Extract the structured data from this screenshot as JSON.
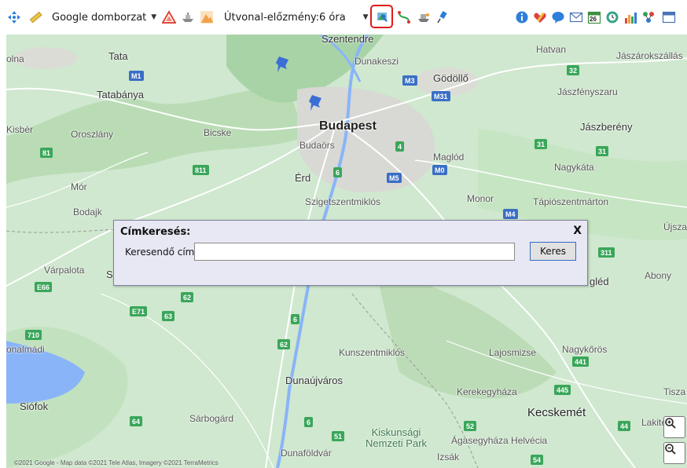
{
  "toolbar": {
    "map_type_select": {
      "value": "Google domborzat"
    },
    "route_history": {
      "label": "Útvonal-előzmény:",
      "value": "6 óra"
    },
    "icons": {
      "left": [
        "move-icon",
        "ruler-icon",
        "triangle-warning-icon",
        "ship-icon",
        "mountain-icon"
      ],
      "middle": [
        "search-place-icon",
        "route-icon",
        "vehicle-icon",
        "pin-icon"
      ],
      "right": [
        "info-icon",
        "heart-icon",
        "speech-bubble-icon",
        "envelope-icon",
        "calendar-icon",
        "clock-icon",
        "bar-chart-icon",
        "tree-icon",
        "window-icon"
      ]
    },
    "calendar_day": "26"
  },
  "map": {
    "places": [
      {
        "id": "szentendre",
        "name": "Szentendre",
        "kind": "mid"
      },
      {
        "id": "hatvan",
        "name": "Hatvan",
        "kind": "small"
      },
      {
        "id": "jaszarokszallas",
        "name": "Jászárokszállás",
        "kind": "small"
      },
      {
        "id": "olna",
        "name": "olna",
        "kind": "small"
      },
      {
        "id": "tata",
        "name": "Tata",
        "kind": "mid"
      },
      {
        "id": "dunakeszi",
        "name": "Dunakeszi",
        "kind": "small"
      },
      {
        "id": "godollo",
        "name": "Gödöllő",
        "kind": "mid"
      },
      {
        "id": "tatabanya",
        "name": "Tatabánya",
        "kind": "mid"
      },
      {
        "id": "jaszfenyszaru",
        "name": "Jászfényszaru",
        "kind": "small"
      },
      {
        "id": "kisber",
        "name": "Kisbér",
        "kind": "small"
      },
      {
        "id": "oroszlany",
        "name": "Oroszlány",
        "kind": "small"
      },
      {
        "id": "bicske",
        "name": "Bicske",
        "kind": "small"
      },
      {
        "id": "budapest",
        "name": "Budapest",
        "kind": "big"
      },
      {
        "id": "jaszbereny",
        "name": "Jászberény",
        "kind": "mid"
      },
      {
        "id": "budaors",
        "name": "Budaörs",
        "kind": "small"
      },
      {
        "id": "maglod",
        "name": "Maglód",
        "kind": "small"
      },
      {
        "id": "nagykata",
        "name": "Nagykáta",
        "kind": "small"
      },
      {
        "id": "erd",
        "name": "Érd",
        "kind": "mid"
      },
      {
        "id": "mor",
        "name": "Mór",
        "kind": "small"
      },
      {
        "id": "szigetszentmiklos",
        "name": "Szigetszentmiklós",
        "kind": "small"
      },
      {
        "id": "monor",
        "name": "Monor",
        "kind": "small"
      },
      {
        "id": "tapioszentmarton",
        "name": "Tápiószentmárton",
        "kind": "small"
      },
      {
        "id": "bodajk",
        "name": "Bodajk",
        "kind": "small"
      },
      {
        "id": "ujsza",
        "name": "Újsza",
        "kind": "small"
      },
      {
        "id": "varpalota",
        "name": "Várpalota",
        "kind": "small"
      },
      {
        "id": "s_frag",
        "name": "S",
        "kind": "mid"
      },
      {
        "id": "cegled",
        "name": "gléd",
        "kind": "mid"
      },
      {
        "id": "abony",
        "name": "Abony",
        "kind": "small"
      },
      {
        "id": "balatonalmadi",
        "name": "onalmádi",
        "kind": "small"
      },
      {
        "id": "kunszentmiklos",
        "name": "Kunszentmiklós",
        "kind": "small"
      },
      {
        "id": "lajosmizse",
        "name": "Lajosmizse",
        "kind": "small"
      },
      {
        "id": "nagykoros",
        "name": "Nagykőrös",
        "kind": "small"
      },
      {
        "id": "dunaujvaros",
        "name": "Dunaújváros",
        "kind": "mid"
      },
      {
        "id": "kerekegyhaza",
        "name": "Kerekegyháza",
        "kind": "small"
      },
      {
        "id": "tisza",
        "name": "Tisza",
        "kind": "small"
      },
      {
        "id": "siofok",
        "name": "Siófok",
        "kind": "mid"
      },
      {
        "id": "sarbogard",
        "name": "Sárbogárd",
        "kind": "small"
      },
      {
        "id": "kecskemet",
        "name": "Kecskemét",
        "kind": "big-ish"
      },
      {
        "id": "lakite",
        "name": "Lakite",
        "kind": "small"
      },
      {
        "id": "kiskunsagi",
        "name": "Kiskunsági\nNemzeti Park",
        "kind": "park"
      },
      {
        "id": "agasegyhaza",
        "name": "Ágasegyháza Helvécia",
        "kind": "small"
      },
      {
        "id": "dunafoldvar",
        "name": "Dunaföldvár",
        "kind": "small"
      },
      {
        "id": "izsak",
        "name": "Izsák",
        "kind": "small"
      }
    ],
    "shields": [
      {
        "id": "s32",
        "label": "32",
        "color": "green"
      },
      {
        "id": "sm1",
        "label": "M1",
        "color": "blue"
      },
      {
        "id": "sm3",
        "label": "M3",
        "color": "blue"
      },
      {
        "id": "sm31",
        "label": "M31",
        "color": "blue"
      },
      {
        "id": "s81",
        "label": "81",
        "color": "green"
      },
      {
        "id": "s4",
        "label": "4",
        "color": "green"
      },
      {
        "id": "s31a",
        "label": "31",
        "color": "green"
      },
      {
        "id": "s31b",
        "label": "31",
        "color": "green"
      },
      {
        "id": "s811",
        "label": "811",
        "color": "green"
      },
      {
        "id": "s6a",
        "label": "6",
        "color": "green"
      },
      {
        "id": "sm5",
        "label": "M5",
        "color": "blue"
      },
      {
        "id": "sm0",
        "label": "M0",
        "color": "blue"
      },
      {
        "id": "sm4",
        "label": "M4",
        "color": "blue"
      },
      {
        "id": "s311",
        "label": "311",
        "color": "green"
      },
      {
        "id": "se66",
        "label": "E66",
        "color": "green"
      },
      {
        "id": "s62a",
        "label": "62",
        "color": "green"
      },
      {
        "id": "se71",
        "label": "E71",
        "color": "green"
      },
      {
        "id": "s63",
        "label": "63",
        "color": "green"
      },
      {
        "id": "s6b",
        "label": "6",
        "color": "green"
      },
      {
        "id": "s710",
        "label": "710",
        "color": "green"
      },
      {
        "id": "s62b",
        "label": "62",
        "color": "green"
      },
      {
        "id": "s441",
        "label": "441",
        "color": "green"
      },
      {
        "id": "s445",
        "label": "445",
        "color": "green"
      },
      {
        "id": "s64",
        "label": "64",
        "color": "green"
      },
      {
        "id": "s6c",
        "label": "6",
        "color": "green"
      },
      {
        "id": "s51",
        "label": "51",
        "color": "green"
      },
      {
        "id": "s52",
        "label": "52",
        "color": "green"
      },
      {
        "id": "s44",
        "label": "44",
        "color": "green"
      },
      {
        "id": "s54",
        "label": "54",
        "color": "green"
      }
    ],
    "copyright": "©2021 Google - Map data ©2021 Tele Atlas, Imagery ©2021 TerraMetrics"
  },
  "dialog": {
    "title": "Címkeresés:",
    "close": "X",
    "label": "Keresendő cím:",
    "input_value": "",
    "search_button": "Keres"
  },
  "colors": {
    "map_base": "#cfe8cf",
    "highlight": "#e11a1a",
    "dialog_bg": "#e8e8f4",
    "water": "#8ab4f8"
  }
}
